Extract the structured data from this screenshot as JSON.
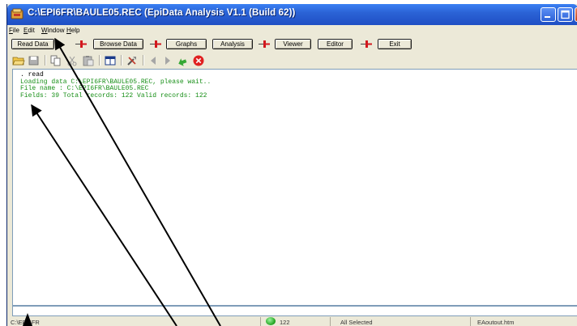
{
  "window": {
    "title": "C:\\EPI6FR\\BAULE05.REC (EpiData Analysis V1.1 (Build 62))"
  },
  "menu": {
    "file": {
      "hot": "F",
      "rest": "ile"
    },
    "edit": {
      "hot": "E",
      "rest": "dit"
    },
    "window": {
      "hot": "W",
      "rest": "indow"
    },
    "help": {
      "hot": "H",
      "rest": "elp"
    }
  },
  "toolbar": {
    "read_data": "Read Data",
    "browse_data": "Browse Data",
    "graphs": "Graphs",
    "analysis": "Analysis",
    "viewer": "Viewer",
    "editor": "Editor",
    "exit": "Exit"
  },
  "icons": [
    "open-folder-icon",
    "save-disk-icon",
    "copy-icon",
    "cut-icon",
    "paste-icon",
    "window-icon",
    "tools-icon",
    "back-arrow-icon",
    "forward-arrow-icon",
    "green-arrow-icon",
    "stop-icon"
  ],
  "output": {
    "lines": [
      {
        "text": ". read",
        "kind": "cmd"
      },
      {
        "text": "Loading data C:\\EPI6FR\\BAULE05.REC, please wait..",
        "kind": "log"
      },
      {
        "text": "File name  : C:\\EPI6FR\\BAULE05.REC",
        "kind": "log"
      },
      {
        "text": "Fields: 39 Total records: 122 Valid records: 122",
        "kind": "log"
      }
    ]
  },
  "command_input": {
    "value": ""
  },
  "status": {
    "folder": "C:\\EPI6FR",
    "records": "122",
    "selection": "All Selected",
    "output_file": "EAoutout.htm"
  },
  "colors": {
    "title_bar": "#2b63d6",
    "output_text": "#178f17",
    "pin_red": "#d2181e"
  }
}
